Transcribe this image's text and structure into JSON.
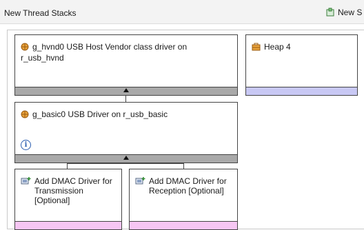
{
  "header": {
    "title": "New Thread Stacks",
    "new_stack_label": "New S"
  },
  "stacks": {
    "hvnd": {
      "label": "g_hvnd0 USB Host Vendor class driver on r_usb_hvnd",
      "icon": "module-icon"
    },
    "heap": {
      "label": "Heap 4",
      "icon": "heap-icon"
    },
    "basic": {
      "label": "g_basic0 USB Driver on r_usb_basic",
      "icon": "module-icon",
      "info_icon": "info-icon"
    },
    "dmac_tx": {
      "label": "Add DMAC Driver for Transmission [Optional]",
      "icon": "add-module-icon"
    },
    "dmac_rx": {
      "label": "Add DMAC Driver for Reception [Optional]",
      "icon": "add-module-icon"
    }
  },
  "colors": {
    "bar_gray": "#a9a9a9",
    "bar_blue": "#c8c8f4",
    "bar_pink": "#f6c6f3",
    "module_orange": "#e8a23a"
  }
}
